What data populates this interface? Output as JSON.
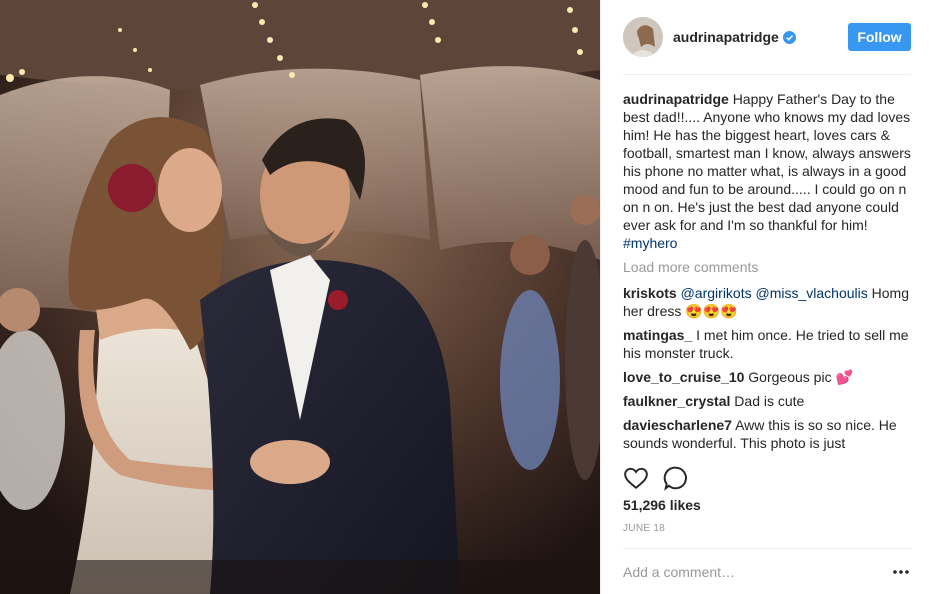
{
  "post": {
    "username": "audrinapatridge",
    "follow_label": "Follow",
    "caption": "Happy Father's Day to the best dad!!.... Anyone who knows my dad loves him! He has the biggest heart, loves cars & football, smartest man I know, always answers his phone no matter what, is always in a good mood and fun to be around..... I could go on n on n on. He's just the best dad anyone could ever ask for and I'm so thankful for him!",
    "caption_hashtag": "#myhero",
    "load_more": "Load more comments",
    "likes": "51,296 likes",
    "date": "JUNE 18",
    "comment_placeholder": "Add a comment…",
    "verified_icon": "verified-badge-icon",
    "accent_color": "#3897f0"
  },
  "comments": [
    {
      "user": "kriskots",
      "mention1": "@argirikots",
      "mention2": "@miss_vlachoulis",
      "text": " Homg her dress 😍😍😍"
    },
    {
      "user": "matingas_",
      "text": " I met him once. He tried to sell me his monster truck."
    },
    {
      "user": "love_to_cruise_10",
      "text": " Gorgeous pic 💕"
    },
    {
      "user": "faulkner_crystal",
      "text": " Dad is cute"
    },
    {
      "user": "daviescharlene7",
      "text": " Aww this is so so nice. He sounds wonderful. This photo is just"
    }
  ],
  "icons": {
    "like": "heart-icon",
    "comment": "comment-bubble-icon",
    "more": "more-options-icon"
  }
}
